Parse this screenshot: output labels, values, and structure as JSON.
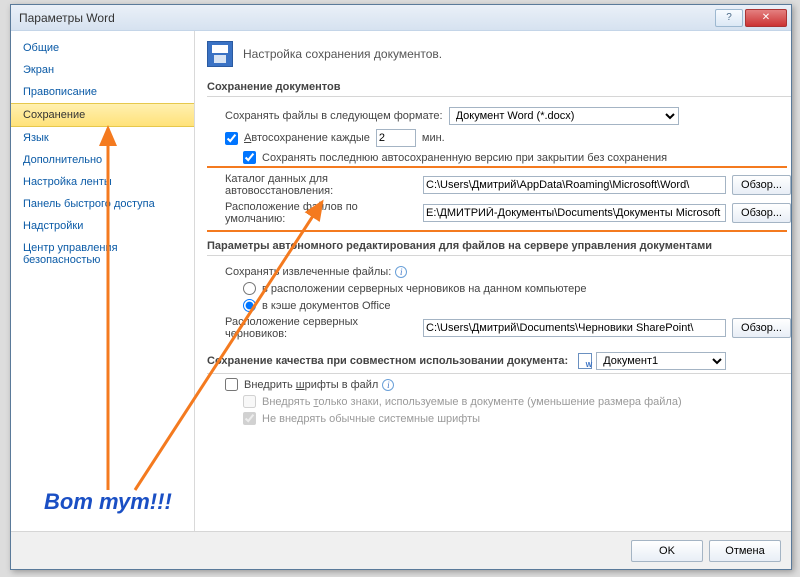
{
  "window": {
    "title": "Параметры Word"
  },
  "sidebar": {
    "items": [
      "Общие",
      "Экран",
      "Правописание",
      "Сохранение",
      "Язык",
      "Дополнительно",
      "Настройка ленты",
      "Панель быстрого доступа",
      "Надстройки",
      "Центр управления безопасностью"
    ],
    "selected_index": 3
  },
  "header": {
    "text": "Настройка сохранения документов."
  },
  "sec1": {
    "title": "Сохранение документов",
    "save_format_label": "Сохранять файлы в следующем формате:",
    "save_format_value": "Документ Word (*.docx)",
    "autosave_label_a": "А",
    "autosave_label_rest": "втосохранение каждые",
    "autosave_minutes": "2",
    "autosave_unit": "мин.",
    "keep_last": "Сохранять последнюю автосохраненную версию при закрытии без сохранения",
    "recover_path_label": "Каталог данных для автовосстановления:",
    "recover_path_value": "C:\\Users\\Дмитрий\\AppData\\Roaming\\Microsoft\\Word\\",
    "default_path_label": "Расположение файлов по умолчанию:",
    "default_path_value": "E:\\ДМИТРИЙ-Документы\\Documents\\Документы Microsoft Word",
    "browse": "Обзор..."
  },
  "sec2": {
    "title": "Параметры автономного редактирования для файлов на сервере управления документами",
    "save_checked_label": "Сохранять извлеченные файлы:",
    "opt_server": "в расположении серверных черновиков на данном компьютере",
    "opt_cache": "в кэше документов Office",
    "drafts_label": "Расположение серверных черновиков:",
    "drafts_value": "C:\\Users\\Дмитрий\\Documents\\Черновики SharePoint\\"
  },
  "sec3": {
    "title": "Сохранение качества при совместном использовании документа:",
    "doc_name": "Документ1",
    "embed_fonts_pre": "Внедрить ",
    "embed_fonts_key": "ш",
    "embed_fonts_rest": "рифты в файл",
    "only_used_pre": "Внедрять ",
    "only_used_key": "т",
    "only_used_rest": "олько знаки, используемые в документе (уменьшение размера файла)",
    "no_system": "Не внедрять обычные системные шрифты"
  },
  "buttons": {
    "ok": "OK",
    "cancel": "Отмена"
  },
  "annotation": {
    "text": "Вот тут!!!"
  }
}
